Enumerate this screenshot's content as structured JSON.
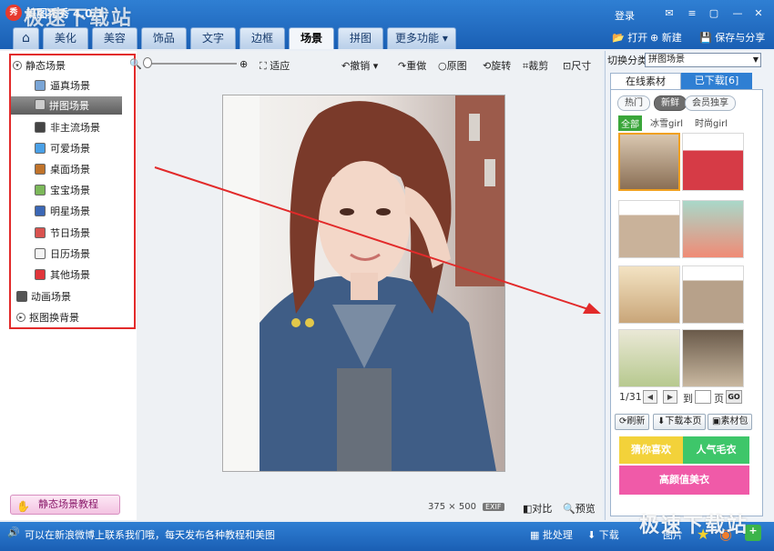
{
  "app": {
    "title": "美图秀秀 4.0.1",
    "login": "登录",
    "win_controls": [
      "▢",
      "—",
      "✕"
    ]
  },
  "watermark": {
    "top": "极速下载站",
    "bottom": "极速下载站"
  },
  "tabs": [
    {
      "label": "⌂"
    },
    {
      "label": "美化"
    },
    {
      "label": "美容"
    },
    {
      "label": "饰品"
    },
    {
      "label": "文字"
    },
    {
      "label": "边框"
    },
    {
      "label": "场景"
    },
    {
      "label": "拼图"
    },
    {
      "label": "更多功能 ▾"
    }
  ],
  "top_actions": {
    "open": "打开",
    "new": "新建",
    "save": "保存与分享"
  },
  "left": {
    "static_category": "静态场景",
    "items": [
      "逼真场景",
      "拼图场景",
      "非主流场景",
      "可爱场景",
      "桌面场景",
      "宝宝场景",
      "明星场景",
      "节日场景",
      "日历场景",
      "其他场景"
    ],
    "animated_category": "动画场景",
    "cutout_category": "抠图换背景",
    "tutorial": "静态场景教程"
  },
  "toolbar": {
    "fit": "适应",
    "undo": "撤销",
    "redo": "重做",
    "original": "原图",
    "rotate": "旋转",
    "crop": "裁剪",
    "size": "尺寸"
  },
  "canvas": {
    "width": "375",
    "x": "×",
    "height": "500",
    "exif": "EXIF",
    "compare": "对比",
    "preview": "预览"
  },
  "right": {
    "switch_label": "切换分类",
    "switch_value": "拼图场景",
    "tab_online": "在线素材",
    "tab_downloaded": "已下载[6]",
    "chips": [
      "热门",
      "新鲜",
      "会员独享"
    ],
    "filters": [
      "全部",
      "冰雪girl",
      "时尚girl"
    ],
    "page": "1/31",
    "to": "到",
    "page_unit": "页",
    "go": "GO",
    "refresh": "刷新",
    "download_page": "下载本页",
    "package": "素材包",
    "ad1": "猜你喜欢",
    "ad2": "人气毛衣",
    "ad3": "高颜值美衣"
  },
  "status": {
    "message": "可以在新浪微博上联系我们哦，每天发布各种教程和美图",
    "batch": "批处理",
    "download": "下载",
    "photos": "图片"
  },
  "colors": {
    "accent": "#2f7fd3",
    "highlight": "#e22a2a",
    "selected_thumb": "#f0a020"
  }
}
